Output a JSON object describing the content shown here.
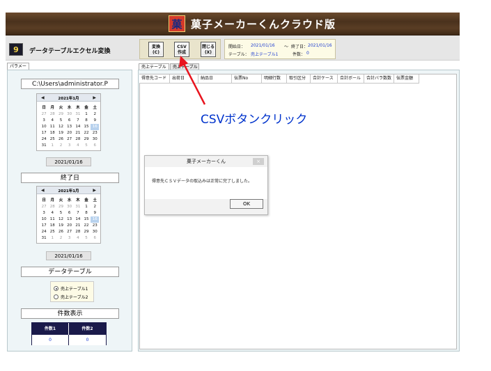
{
  "banner": {
    "logo": "菓",
    "title": "菓子メーカーくんクラウド版"
  },
  "app": {
    "icon": "9",
    "name": "データテーブルエクセル変換"
  },
  "toolbar": {
    "convert": [
      "変換",
      "(C)"
    ],
    "csv": [
      "CSV",
      "作成"
    ],
    "close": [
      "閉じる",
      "(X)"
    ]
  },
  "info": {
    "start_label": "開始日：",
    "start_value": "2021/01/16",
    "tilde": "〜",
    "end_label": "終了日：",
    "end_value": "2021/01/16",
    "table_label": "テーブル：",
    "table_value": "売上テーブル1",
    "count_label": "件数：",
    "count_value": "0"
  },
  "left": {
    "tab": "パラメータ",
    "path": "C:\\Users\\administrator.P",
    "calendar1": {
      "prev": "◀",
      "next": "▶",
      "month": "2021年1月"
    },
    "date1": "2021/01/16",
    "end_label": "終了日",
    "calendar2": {
      "prev": "◀",
      "next": "▶",
      "month": "2021年1月"
    },
    "date2": "2021/01/16",
    "table_label": "データテーブル",
    "radios": [
      "売上テーブル1",
      "売上テーブル2"
    ],
    "count_label": "件数表示",
    "count_headers": [
      "件数1",
      "件数2"
    ],
    "count_values": [
      "0",
      "0"
    ]
  },
  "calendar": {
    "weekdays": [
      "日",
      "月",
      "火",
      "水",
      "木",
      "金",
      "土"
    ],
    "weeks": [
      [
        "27",
        "28",
        "29",
        "30",
        "31",
        "1",
        "2"
      ],
      [
        "3",
        "4",
        "5",
        "6",
        "7",
        "8",
        "9"
      ],
      [
        "10",
        "11",
        "12",
        "13",
        "14",
        "15",
        "16"
      ],
      [
        "17",
        "18",
        "19",
        "20",
        "21",
        "22",
        "23"
      ],
      [
        "24",
        "25",
        "26",
        "27",
        "28",
        "29",
        "30"
      ],
      [
        "31",
        "1",
        "2",
        "3",
        "4",
        "5",
        "6"
      ]
    ]
  },
  "right": {
    "tabs": [
      "売上テーブル1",
      "売上テーブル"
    ],
    "columns": [
      "得意先コード",
      "出荷日",
      "納品日",
      "伝票No",
      "明細行数",
      "取引区分",
      "合計ケース",
      "合計ボール",
      "合計バラ数数",
      "伝票金額"
    ]
  },
  "dialog": {
    "title": "菓子メーカーくん",
    "close": "×",
    "message": "得意先ＣＳＶデータの取込みは正常に完了しました。",
    "ok": "OK"
  },
  "annotation": "CSVボタンクリック",
  "colors": {
    "annotation": "#0033cc",
    "arrow": "#e8141e",
    "selected_day": "#b8d2ee"
  }
}
